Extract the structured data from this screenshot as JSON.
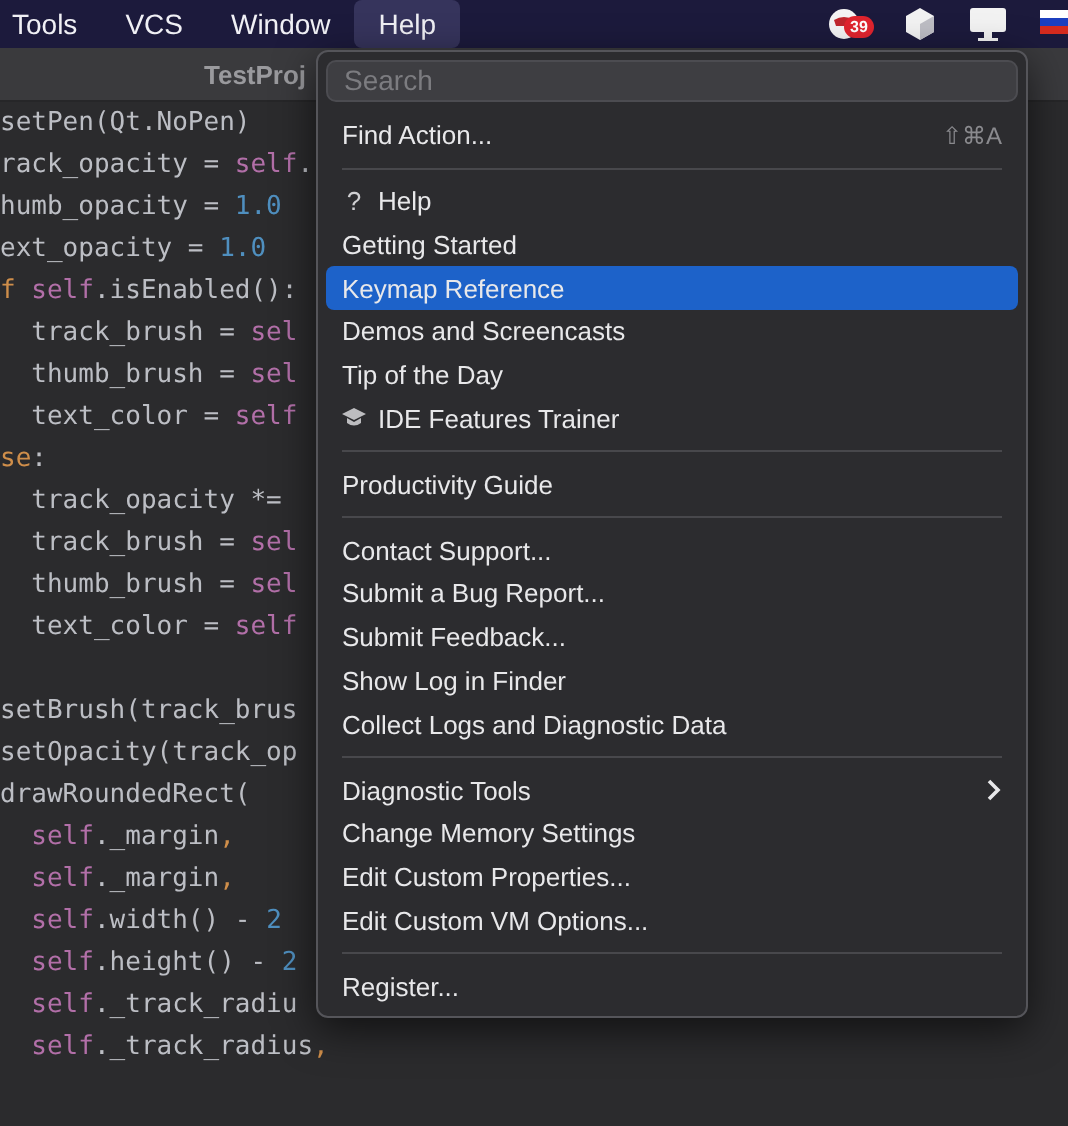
{
  "menu_bar": {
    "items": [
      {
        "label": "Tools",
        "selected": false
      },
      {
        "label": "VCS",
        "selected": false
      },
      {
        "label": "Window",
        "selected": false
      },
      {
        "label": "Help",
        "selected": true
      }
    ],
    "notification_badge": "39"
  },
  "editor": {
    "title": "TestProj",
    "lines": [
      {
        "kind": "code",
        "tokens": [
          {
            "text": "setPen(Qt.NoPen)",
            "kind": "plain"
          }
        ]
      },
      {
        "kind": "code",
        "tokens": [
          {
            "text": "rack_opacity = ",
            "kind": "plain"
          },
          {
            "text": "self",
            "kind": "self"
          },
          {
            "text": ".",
            "kind": "plain"
          }
        ]
      },
      {
        "kind": "code",
        "tokens": [
          {
            "text": "humb_opacity = ",
            "kind": "plain"
          },
          {
            "text": "1.0",
            "kind": "number"
          }
        ]
      },
      {
        "kind": "code",
        "tokens": [
          {
            "text": "ext_opacity = ",
            "kind": "plain"
          },
          {
            "text": "1.0",
            "kind": "number"
          }
        ]
      },
      {
        "kind": "code",
        "tokens": [
          {
            "text": "f ",
            "kind": "keyword"
          },
          {
            "text": "self",
            "kind": "self"
          },
          {
            "text": ".isEnabled():",
            "kind": "plain"
          }
        ]
      },
      {
        "kind": "code",
        "tokens": [
          {
            "text": "  track_brush = ",
            "kind": "plain"
          },
          {
            "text": "sel",
            "kind": "self"
          }
        ]
      },
      {
        "kind": "code",
        "tokens": [
          {
            "text": "  thumb_brush = ",
            "kind": "plain"
          },
          {
            "text": "sel",
            "kind": "self"
          }
        ]
      },
      {
        "kind": "code",
        "tokens": [
          {
            "text": "  text_color = ",
            "kind": "plain"
          },
          {
            "text": "self",
            "kind": "self"
          }
        ]
      },
      {
        "kind": "code",
        "tokens": [
          {
            "text": "se",
            "kind": "keyword"
          },
          {
            "text": ":",
            "kind": "plain"
          }
        ]
      },
      {
        "kind": "code",
        "tokens": [
          {
            "text": "  track_opacity *=",
            "kind": "plain"
          }
        ]
      },
      {
        "kind": "code",
        "tokens": [
          {
            "text": "  track_brush = ",
            "kind": "plain"
          },
          {
            "text": "sel",
            "kind": "self"
          }
        ]
      },
      {
        "kind": "code",
        "tokens": [
          {
            "text": "  thumb_brush = ",
            "kind": "plain"
          },
          {
            "text": "sel",
            "kind": "self"
          }
        ]
      },
      {
        "kind": "code",
        "tokens": [
          {
            "text": "  text_color = ",
            "kind": "plain"
          },
          {
            "text": "self",
            "kind": "self"
          }
        ]
      },
      {
        "kind": "blank"
      },
      {
        "kind": "code",
        "tokens": [
          {
            "text": "setBrush(track_brus",
            "kind": "plain"
          }
        ]
      },
      {
        "kind": "code",
        "tokens": [
          {
            "text": "setOpacity(track_op",
            "kind": "plain"
          }
        ]
      },
      {
        "kind": "code",
        "tokens": [
          {
            "text": "drawRoundedRect(",
            "kind": "plain"
          }
        ]
      },
      {
        "kind": "code",
        "tokens": [
          {
            "text": "  self",
            "kind": "self"
          },
          {
            "text": "._margin",
            "kind": "plain"
          },
          {
            "text": ",",
            "kind": "keyword"
          }
        ]
      },
      {
        "kind": "code",
        "tokens": [
          {
            "text": "  self",
            "kind": "self"
          },
          {
            "text": "._margin",
            "kind": "plain"
          },
          {
            "text": ",",
            "kind": "keyword"
          }
        ]
      },
      {
        "kind": "code",
        "tokens": [
          {
            "text": "  self",
            "kind": "self"
          },
          {
            "text": ".width() - ",
            "kind": "plain"
          },
          {
            "text": "2",
            "kind": "number"
          }
        ]
      },
      {
        "kind": "code",
        "tokens": [
          {
            "text": "  self",
            "kind": "self"
          },
          {
            "text": ".height() - ",
            "kind": "plain"
          },
          {
            "text": "2",
            "kind": "number"
          }
        ]
      },
      {
        "kind": "code",
        "tokens": [
          {
            "text": "  self",
            "kind": "self"
          },
          {
            "text": "._track_radiu",
            "kind": "plain"
          }
        ]
      },
      {
        "kind": "code",
        "tokens": [
          {
            "text": "  self",
            "kind": "self"
          },
          {
            "text": "._track_radius",
            "kind": "plain"
          },
          {
            "text": ",",
            "kind": "keyword"
          }
        ]
      }
    ]
  },
  "help_menu": {
    "search": {
      "placeholder": "Search"
    },
    "groups": [
      [
        {
          "label": "Find Action...",
          "shortcut": "⇧⌘A",
          "kind": "plain",
          "selected": false
        }
      ],
      [
        {
          "label": "Help",
          "glyph": "?",
          "kind": "help",
          "selected": false
        },
        {
          "label": "Getting Started",
          "kind": "plain",
          "selected": false
        },
        {
          "label": "Keymap Reference",
          "kind": "plain",
          "selected": true
        },
        {
          "label": "Demos and Screencasts",
          "kind": "plain",
          "selected": false
        },
        {
          "label": "Tip of the Day",
          "kind": "plain",
          "selected": false
        },
        {
          "label": "IDE Features Trainer",
          "kind": "trainer",
          "selected": false
        }
      ],
      [
        {
          "label": "Productivity Guide",
          "kind": "plain",
          "selected": false
        }
      ],
      [
        {
          "label": "Contact Support...",
          "kind": "plain",
          "selected": false
        },
        {
          "label": "Submit a Bug Report...",
          "kind": "plain",
          "selected": false
        },
        {
          "label": "Submit Feedback...",
          "kind": "plain",
          "selected": false
        },
        {
          "label": "Show Log in Finder",
          "kind": "plain",
          "selected": false
        },
        {
          "label": "Collect Logs and Diagnostic Data",
          "kind": "plain",
          "selected": false
        }
      ],
      [
        {
          "label": "Diagnostic Tools",
          "kind": "submenu",
          "selected": false
        },
        {
          "label": "Change Memory Settings",
          "kind": "plain",
          "selected": false
        },
        {
          "label": "Edit Custom Properties...",
          "kind": "plain",
          "selected": false
        },
        {
          "label": "Edit Custom VM Options...",
          "kind": "plain",
          "selected": false
        }
      ],
      [
        {
          "label": "Register...",
          "kind": "plain",
          "selected": false
        }
      ]
    ]
  }
}
